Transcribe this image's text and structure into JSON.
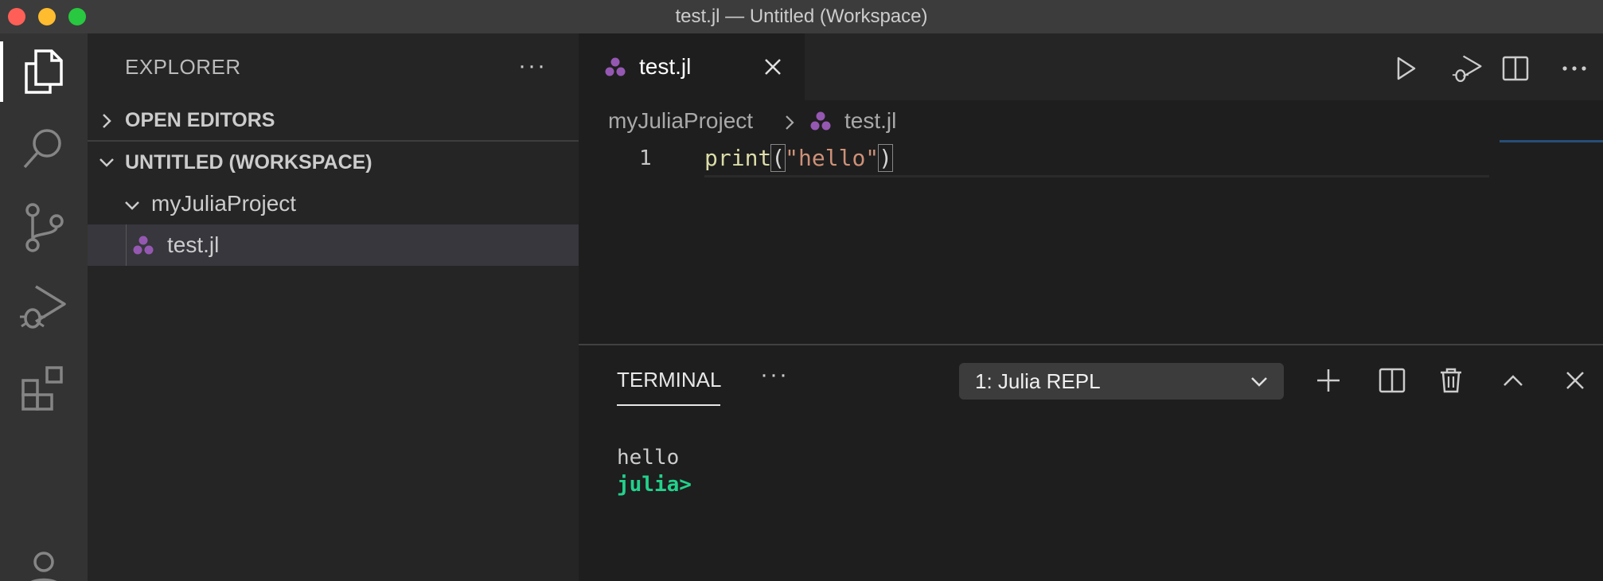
{
  "window": {
    "title": "test.jl — Untitled (Workspace)"
  },
  "activity_bar": {
    "items": [
      {
        "name": "explorer",
        "icon": "files-icon",
        "active": true
      },
      {
        "name": "search",
        "icon": "search-icon",
        "active": false
      },
      {
        "name": "source-control",
        "icon": "source-control-icon",
        "active": false
      },
      {
        "name": "run-and-debug",
        "icon": "run-debug-icon",
        "active": false
      },
      {
        "name": "extensions",
        "icon": "extensions-icon",
        "active": false
      },
      {
        "name": "accounts",
        "icon": "account-icon",
        "active": false
      }
    ]
  },
  "sidebar": {
    "title": "EXPLORER",
    "more_label": "···",
    "sections": {
      "open_editors": "OPEN EDITORS",
      "workspace": "UNTITLED (WORKSPACE)"
    },
    "tree": {
      "folder": "myJuliaProject",
      "file": "test.jl"
    }
  },
  "editor": {
    "tab": {
      "label": "test.jl",
      "icon": "julia-file-icon"
    },
    "breadcrumb": {
      "folder": "myJuliaProject",
      "file": "test.jl"
    },
    "line_number": "1",
    "code": {
      "fn": "print",
      "open_paren": "(",
      "string": "\"hello\"",
      "close_paren": ")"
    },
    "actions": [
      "run-icon",
      "debug-run-icon",
      "split-editor-icon",
      "more-icon"
    ]
  },
  "panel": {
    "tab": "TERMINAL",
    "more_label": "···",
    "terminal_select": "1: Julia REPL",
    "actions": [
      "plus-icon",
      "split-terminal-icon",
      "trash-icon",
      "chevron-up-icon",
      "close-icon"
    ],
    "output": [
      "hello"
    ],
    "prompt": "julia>"
  },
  "colors": {
    "julia_purple": "#9558b2",
    "prompt_green": "#23d18b",
    "string": "#ce9178",
    "function": "#dcdcaa"
  }
}
